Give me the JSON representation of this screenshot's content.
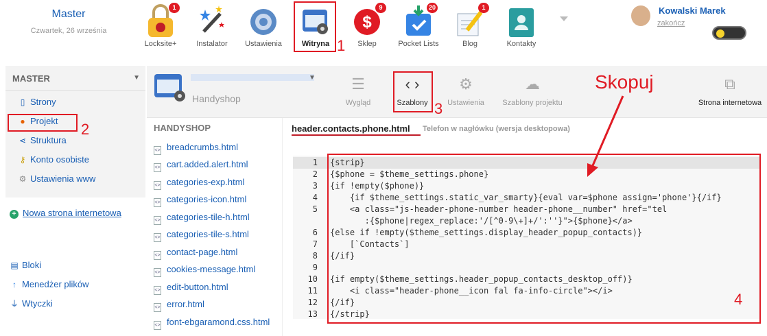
{
  "brand": {
    "name": "Master",
    "date": "Czwartek, 26 września"
  },
  "apps": [
    {
      "label": "Locksite+",
      "badge": "1"
    },
    {
      "label": "Instalator",
      "badge": ""
    },
    {
      "label": "Ustawienia",
      "badge": ""
    },
    {
      "label": "Witryna",
      "badge": ""
    },
    {
      "label": "Sklep",
      "badge": "9"
    },
    {
      "label": "Pocket Lists",
      "badge": "20"
    },
    {
      "label": "Blog",
      "badge": "1"
    },
    {
      "label": "Kontakty",
      "badge": ""
    }
  ],
  "user": {
    "name": "Kowalski Marek",
    "logout": "zakończ"
  },
  "sidebar": {
    "title": "MASTER",
    "items": [
      "Strony",
      "Projekt",
      "Struktura",
      "Konto osobiste",
      "Ustawienia www"
    ],
    "new_site": "Nowa strona internetowa",
    "tools": [
      "Bloki",
      "Menedżer plików",
      "Wtyczki"
    ]
  },
  "site": {
    "sub": "Handyshop"
  },
  "toolbar": [
    "Wygląd",
    "Szablony",
    "Ustawienia",
    "Szablony projektu",
    "Strona internetowa"
  ],
  "files": {
    "title": "HANDYSHOP",
    "items": [
      "breadcrumbs.html",
      "cart.added.alert.html",
      "categories-exp.html",
      "categories-icon.html",
      "categories-tile-h.html",
      "categories-tile-s.html",
      "contact-page.html",
      "cookies-message.html",
      "edit-button.html",
      "error.html",
      "font-ebgaramond.css.html"
    ]
  },
  "editor": {
    "filename": "header.contacts.phone.html",
    "description": "Telefon w nagłówku (wersja desktopowa)",
    "lines": [
      "{strip}",
      "{$phone = $theme_settings.phone}",
      "{if !empty($phone)}",
      "    {if $theme_settings.static_var_smarty}{eval var=$phone assign='phone'}{/if}",
      "    <a class=\"js-header-phone-number header-phone__number\" href=\"tel",
      "       :{$phone|regex_replace:'/[^0-9\\+]+/':''}\">{$phone}</a>",
      "{else if !empty($theme_settings.display_header_popup_contacts)}",
      "    [`Contacts`]",
      "{/if}",
      "",
      "{if empty($theme_settings.header_popup_contacts_desktop_off)}",
      "    <i class=\"header-phone__icon fal fa-info-circle\"></i>",
      "{/if}",
      "{/strip}"
    ],
    "numbers": [
      "1",
      "2",
      "3",
      "4",
      "5",
      "",
      "6",
      "7",
      "8",
      "9",
      "10",
      "11",
      "12",
      "13"
    ]
  },
  "annotations": {
    "n1": "1",
    "n2": "2",
    "n3": "3",
    "n4": "4",
    "skopuj": "Skopuj"
  },
  "colors": {
    "link": "#1a5fb4",
    "annotation": "#e01b24"
  }
}
